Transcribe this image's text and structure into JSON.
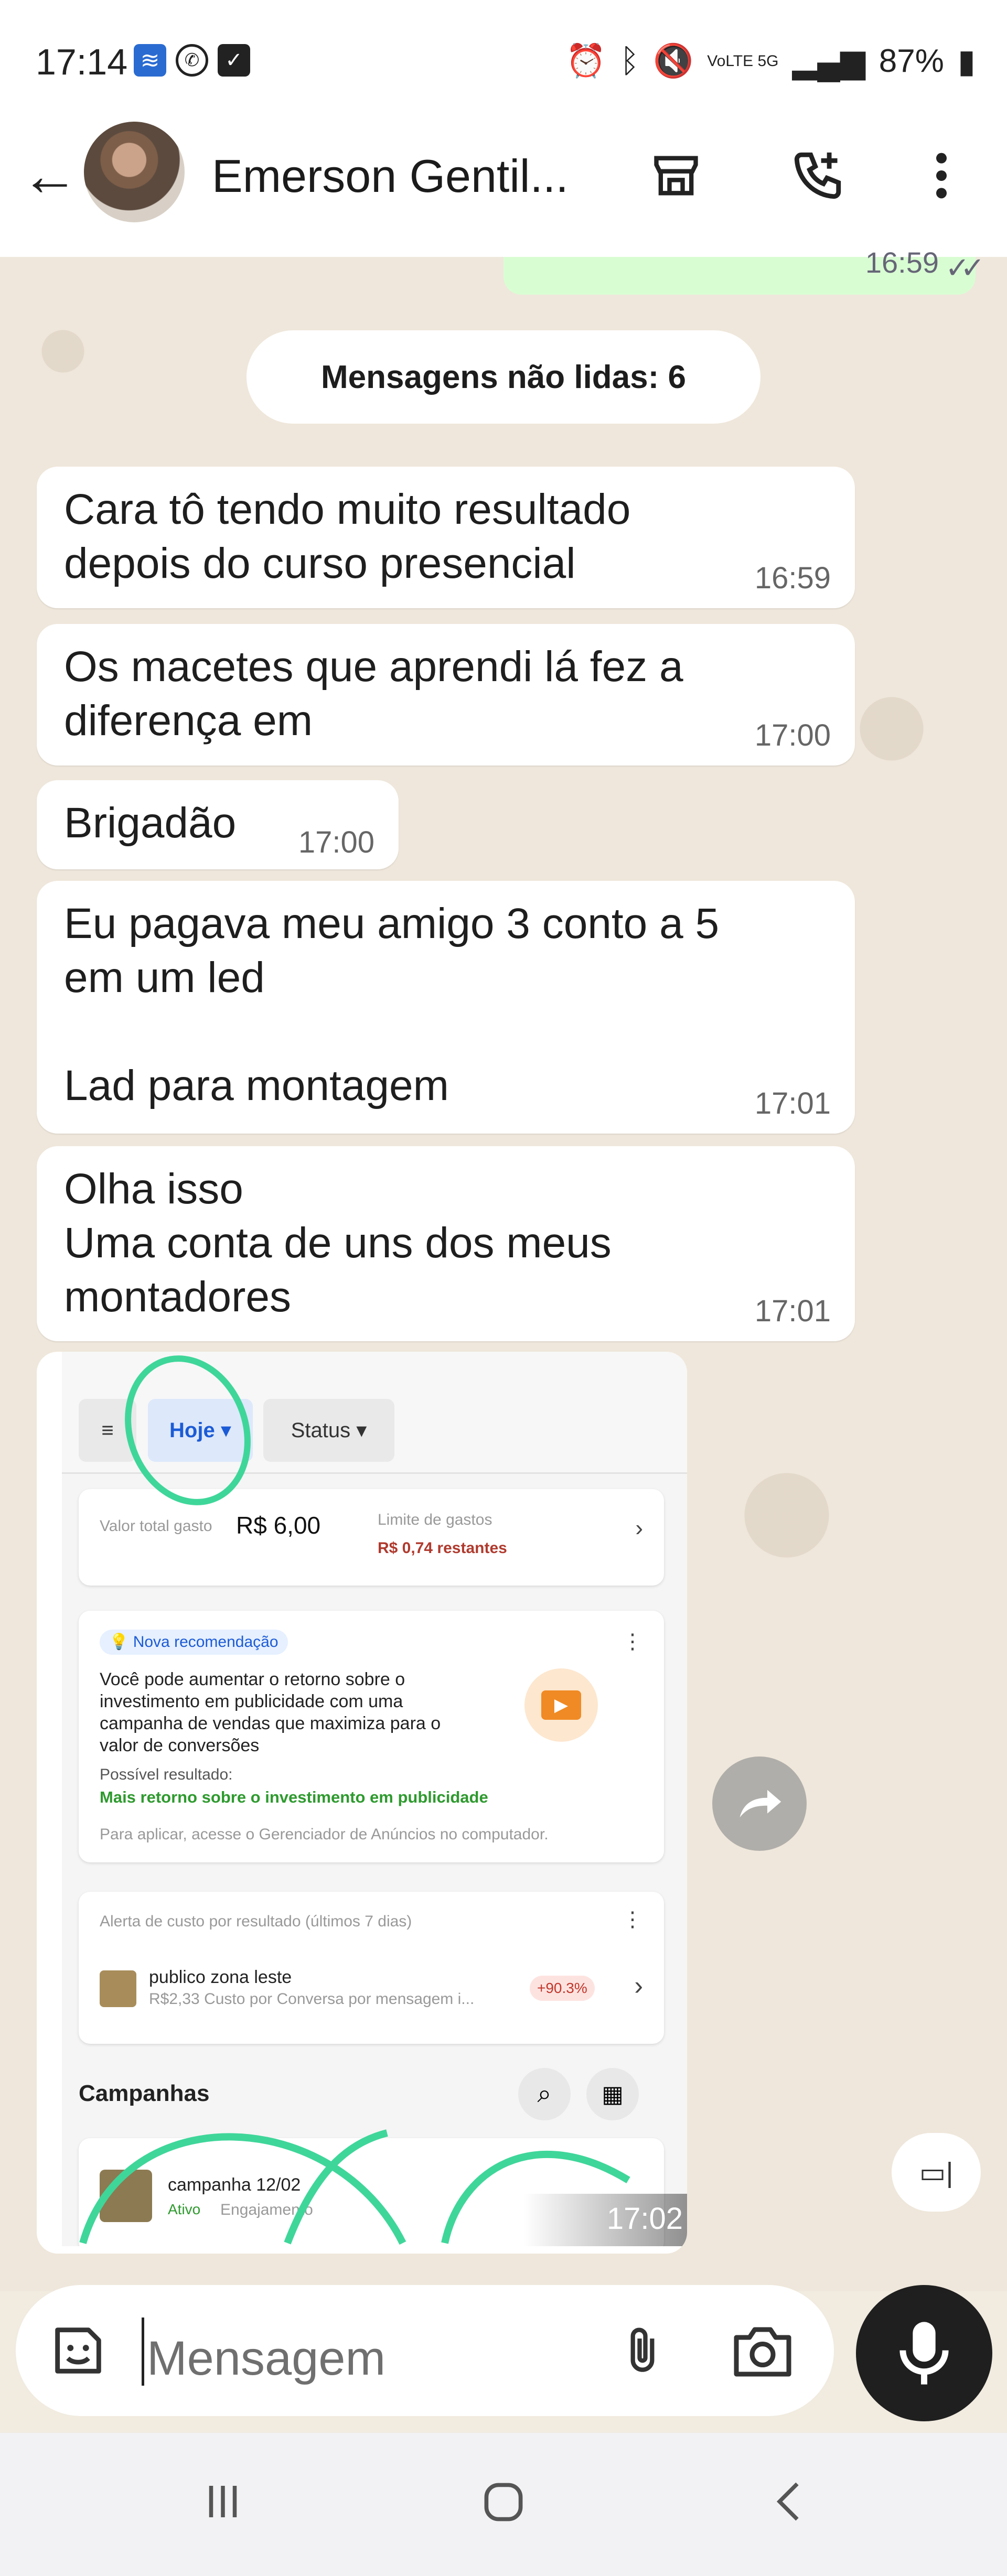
{
  "status_bar": {
    "time": "17:14",
    "battery": "87%",
    "network": "VoLTE 5G"
  },
  "header": {
    "contact_name": "Emerson Gentil...",
    "icons": [
      "back-arrow-icon",
      "store-icon",
      "add-call-icon",
      "more-vert-icon"
    ]
  },
  "chat": {
    "prev_sent_time": "16:59",
    "unread_label": "Mensagens não lidas: 6",
    "messages": [
      {
        "text": "Cara tô tendo muito resultado\ndepois do curso presencial",
        "time": "16:59"
      },
      {
        "text": "Os macetes que aprendi lá fez a\ndiferença em",
        "time": "17:00"
      },
      {
        "text": "Brigadão",
        "time": "17:00"
      },
      {
        "text": "Eu pagava meu amigo 3 conto a 5\nem um led\n\nLad para montagem",
        "time": "17:01"
      },
      {
        "text": "Olha isso\nUma conta de uns dos meus\nmontadores",
        "time": "17:01"
      }
    ],
    "image_message": {
      "time": "17:02",
      "screenshot": {
        "chip_today": "Hoje",
        "chip_status": "Status",
        "spent_label": "Valor total gasto",
        "spent_value": "R$ 6,00",
        "limit_label": "Limite de gastos",
        "limit_value": "R$ 0,74 restantes",
        "rec_badge": "Nova recomendação",
        "rec_text": "Você pode aumentar o retorno sobre o investimento em publicidade com uma campanha de vendas que maximiza para o valor de conversões",
        "result_label": "Possível resultado:",
        "result_value": "Mais retorno sobre o investimento em publicidade",
        "apply_text": "Para aplicar, acesse o Gerenciador de Anúncios no computador.",
        "alert_title": "Alerta de custo por resultado (últimos 7 dias)",
        "alert_item": "publico zona leste",
        "alert_detail": "R$2,33 Custo por Conversa por mensagem i...",
        "alert_pct": "+90.3%",
        "campaigns_title": "Campanhas",
        "campaign_name": "campanha 12/02",
        "campaign_status": "Ativo",
        "campaign_type": "Engajamento"
      }
    }
  },
  "composer": {
    "placeholder": "Mensagem"
  },
  "colors": {
    "chat_bg": "#efe7db",
    "sent_bubble": "#d9fdd3",
    "mic_button": "#1f1f1f",
    "annotation_green": "#3fd69a"
  }
}
